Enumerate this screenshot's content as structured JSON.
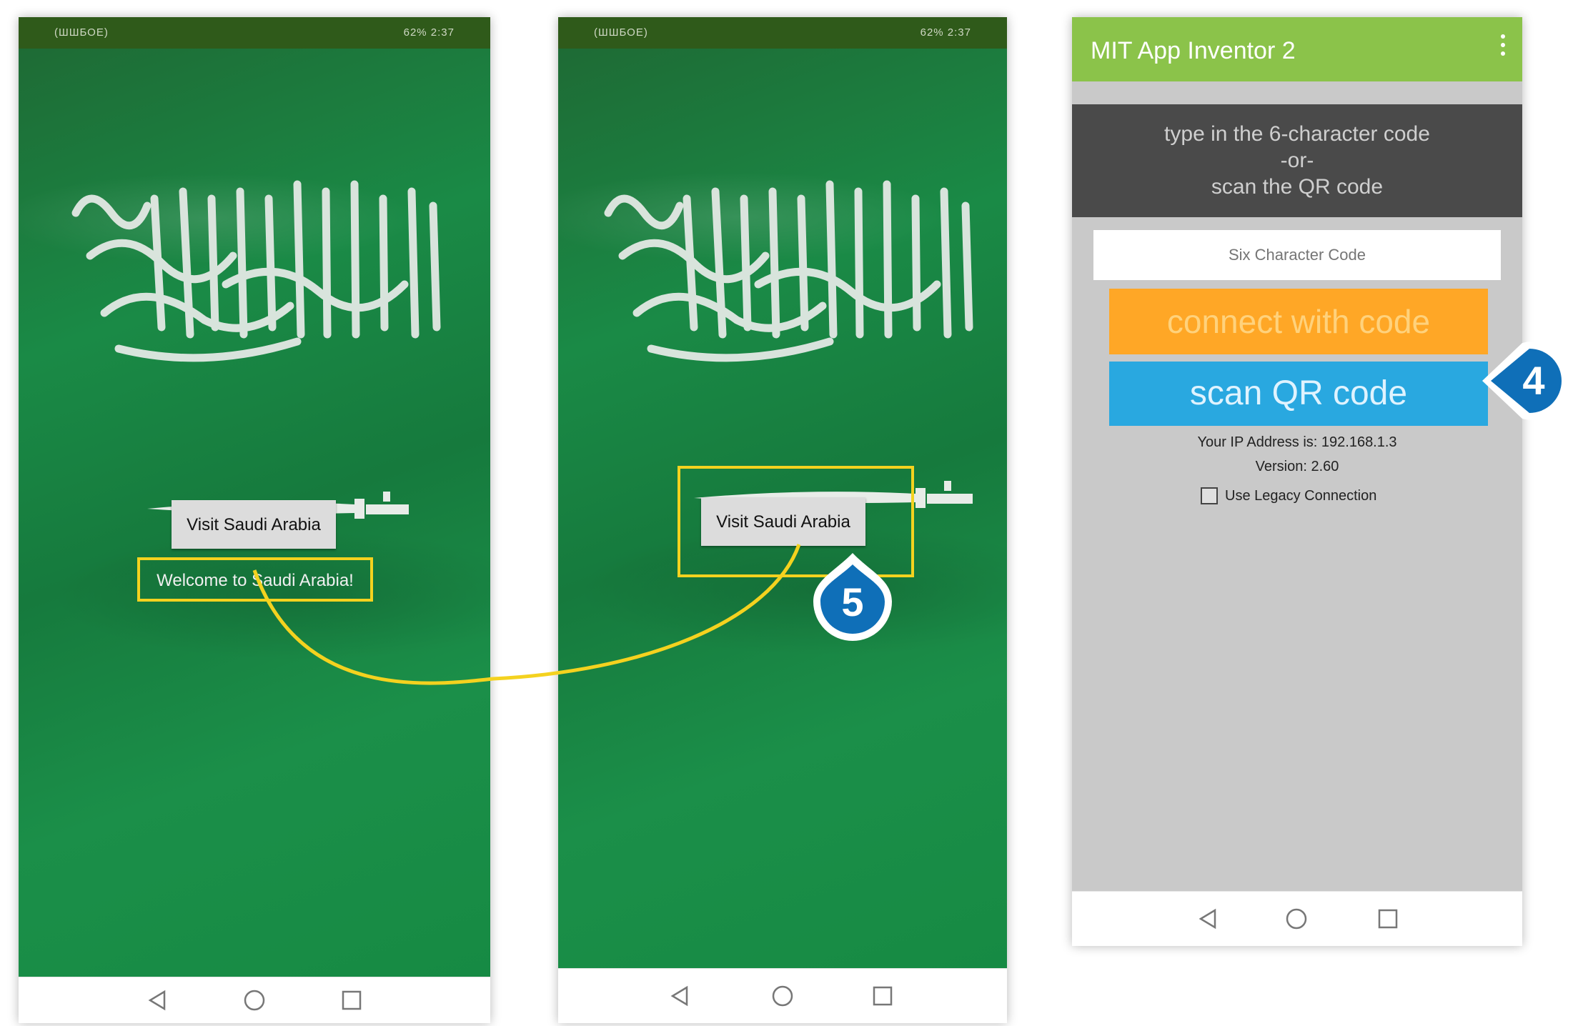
{
  "phone1": {
    "status_left": "(ШШБОЕ)",
    "status_right": "62% 2:37",
    "visit_button": "Visit Saudi Arabia",
    "welcome_label": "Welcome to Saudi Arabia!"
  },
  "phone2": {
    "status_left": "(ШШБОЕ)",
    "status_right": "62% 2:37",
    "visit_button": "Visit Saudi Arabia"
  },
  "phone3": {
    "app_title": "MIT App Inventor 2",
    "instructions": [
      "type in the 6-character code",
      "-or-",
      "scan the QR code"
    ],
    "code_placeholder": "Six Character Code",
    "connect_button": "connect with code",
    "scan_button": "scan QR code",
    "ip_text": "Your IP Address is: 192.168.1.3",
    "version_text": "Version: 2.60",
    "legacy_label": "Use Legacy Connection"
  },
  "callouts": {
    "step4": "4",
    "step5": "5"
  },
  "colors": {
    "flag_green": "#1a8a46",
    "highlight_yellow": "#f4d21f",
    "app_bar_green": "#8bc34a",
    "connect_orange": "#ffa726",
    "scan_blue": "#29a8e0",
    "callout_blue": "#0f6fb8"
  },
  "icons": [
    "back-triangle-icon",
    "home-circle-icon",
    "recents-square-icon",
    "overflow-menu-icon",
    "checkbox-icon"
  ]
}
